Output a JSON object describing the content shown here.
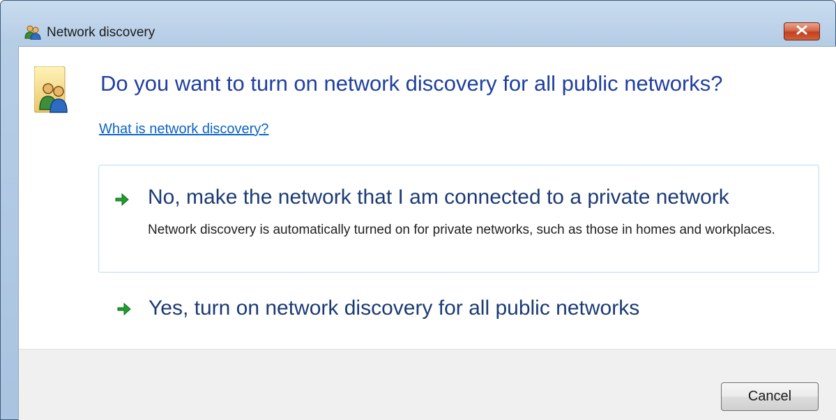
{
  "window": {
    "title": "Network discovery",
    "title_icon": "network-users-icon",
    "close_icon": "close-icon"
  },
  "dialog": {
    "icon": "network-users-icon",
    "question": "Do you want to turn on network discovery for all public networks?",
    "help_link": "What is network discovery?",
    "options": [
      {
        "icon": "green-arrow-icon",
        "title": "No, make the network that I am connected to a private network",
        "description": "Network discovery is automatically turned on for private networks, such as those in homes and workplaces."
      },
      {
        "icon": "green-arrow-icon",
        "title": "Yes, turn on network discovery for all public networks"
      }
    ],
    "cancel_label": "Cancel"
  },
  "colors": {
    "question_text": "#1f3fa0",
    "link": "#0b63c4",
    "option_text": "#1b3a74",
    "arrow_green": "#1e9e2e",
    "close_red": "#c1411f"
  }
}
